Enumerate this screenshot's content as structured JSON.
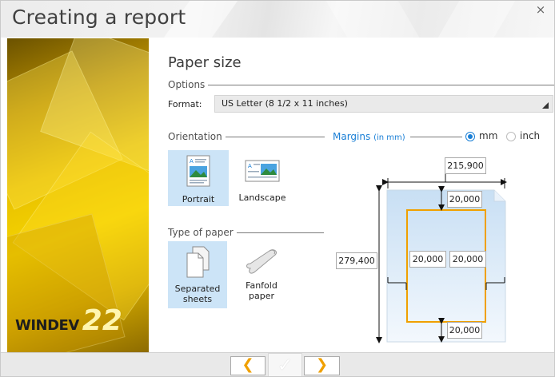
{
  "window": {
    "title": "Creating a report",
    "close_glyph": "×"
  },
  "brand": {
    "name": "WINDEV",
    "version": "22"
  },
  "page": {
    "heading": "Paper size"
  },
  "options": {
    "group_label": "Options",
    "format_label": "Format:",
    "format_value": "US Letter (8 1/2 x 11 inches)"
  },
  "orientation": {
    "group_label": "Orientation",
    "items": [
      {
        "label": "Portrait",
        "selected": true
      },
      {
        "label": "Landscape",
        "selected": false
      }
    ]
  },
  "paper_type": {
    "group_label": "Type of paper",
    "items": [
      {
        "label_line1": "Separated",
        "label_line2": "sheets",
        "selected": true
      },
      {
        "label_line1": "Fanfold",
        "label_line2": "paper",
        "selected": false
      }
    ]
  },
  "margins": {
    "group_label": "Margins",
    "unit_note": "(in mm)",
    "units": [
      {
        "label": "mm",
        "selected": true
      },
      {
        "label": "inch",
        "selected": false
      }
    ],
    "width": "215,900",
    "height": "279,400",
    "top": "20,000",
    "left": "20,000",
    "right": "20,000",
    "bottom": "20,000"
  },
  "nav": {
    "prev_glyph": "❮",
    "finish_glyph": "✓",
    "next_glyph": "❯"
  },
  "colors": {
    "accent": "#1a7fd6",
    "margin_frame": "#f0a000",
    "selected_bg": "#cce4f7"
  }
}
